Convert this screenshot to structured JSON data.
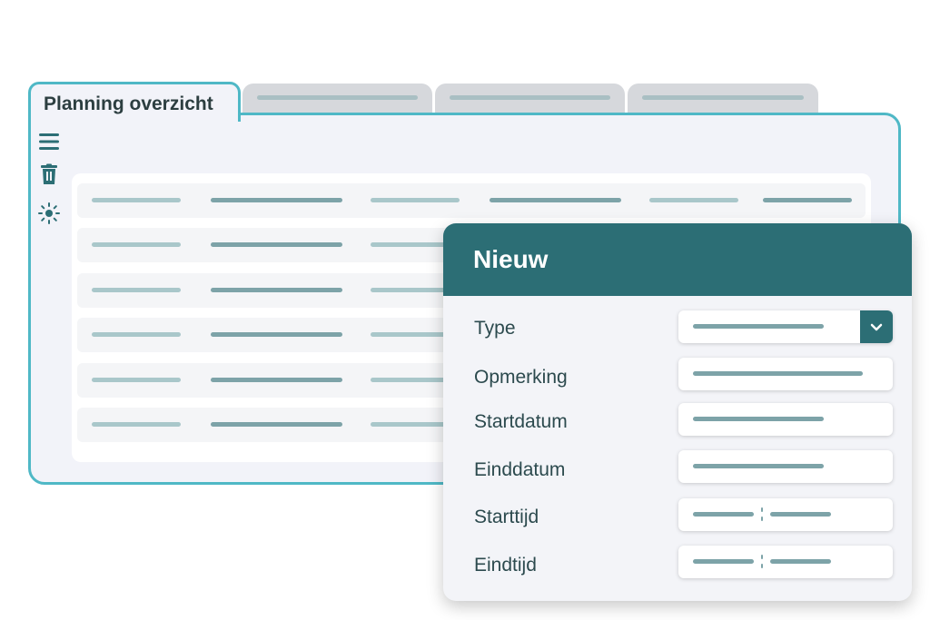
{
  "tabs": [
    {
      "label": "Planning overzicht",
      "active": true
    },
    {
      "label": "",
      "active": false
    },
    {
      "label": "",
      "active": false
    },
    {
      "label": "",
      "active": false
    }
  ],
  "sidebar": {
    "icons": [
      "menu-icon",
      "trash-icon",
      "sun-icon"
    ]
  },
  "dialog": {
    "title": "Nieuw",
    "fields": [
      {
        "label": "Type",
        "kind": "select"
      },
      {
        "label": "Opmerking",
        "kind": "text"
      },
      {
        "label": "Startdatum",
        "kind": "date"
      },
      {
        "label": "Einddatum",
        "kind": "date"
      },
      {
        "label": "Starttijd",
        "kind": "time"
      },
      {
        "label": "Eindtijd",
        "kind": "time"
      }
    ]
  },
  "colors": {
    "accent": "#4fb8c6",
    "header": "#2c6e75",
    "panel_bg": "#f2f3f9",
    "placeholder_light": "#a9c7ca",
    "placeholder_dark": "#7da3a8"
  }
}
